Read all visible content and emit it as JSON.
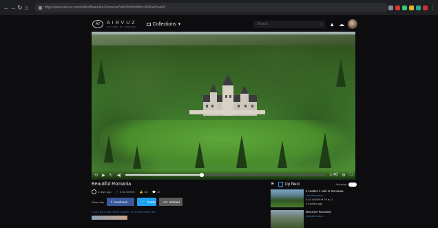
{
  "browser": {
    "url": "https://www.airvuz.com/video/Beautiful-Romania?id=59fa5b58bccd3804c5aa99"
  },
  "header": {
    "brand": "AIRVUZ",
    "tagline": "UNITED BY DRONE",
    "collections_label": "Collections",
    "search_placeholder": "Search"
  },
  "player": {
    "time": "1:46"
  },
  "video": {
    "title": "Beautiful Romania",
    "age": "4 days ago",
    "views": "5.3k VIEWS",
    "likes": "88",
    "comments": "12"
  },
  "share": {
    "label": "Share this",
    "facebook": "Facebook",
    "twitter": "Twitter",
    "embed": "Embed"
  },
  "collection_link": "COLLECTION THIS VIDEO IS FEATURED IN",
  "upnext": {
    "label": "Up Next",
    "autoplay": "Autoplay",
    "items": [
      {
        "title": "2 castles 1 visit in Romania",
        "author": "nicolaitomaiov",
        "stats": "5.1k VIEWS ♥ 79 ● 11",
        "age": "4 months ago"
      },
      {
        "title": "Discover Romania",
        "author": "nicolaitomaiov",
        "stats": "",
        "age": ""
      }
    ]
  },
  "colors": {
    "accent": "#3a86c8",
    "facebook": "#3b5998",
    "twitter": "#1da1f2"
  }
}
